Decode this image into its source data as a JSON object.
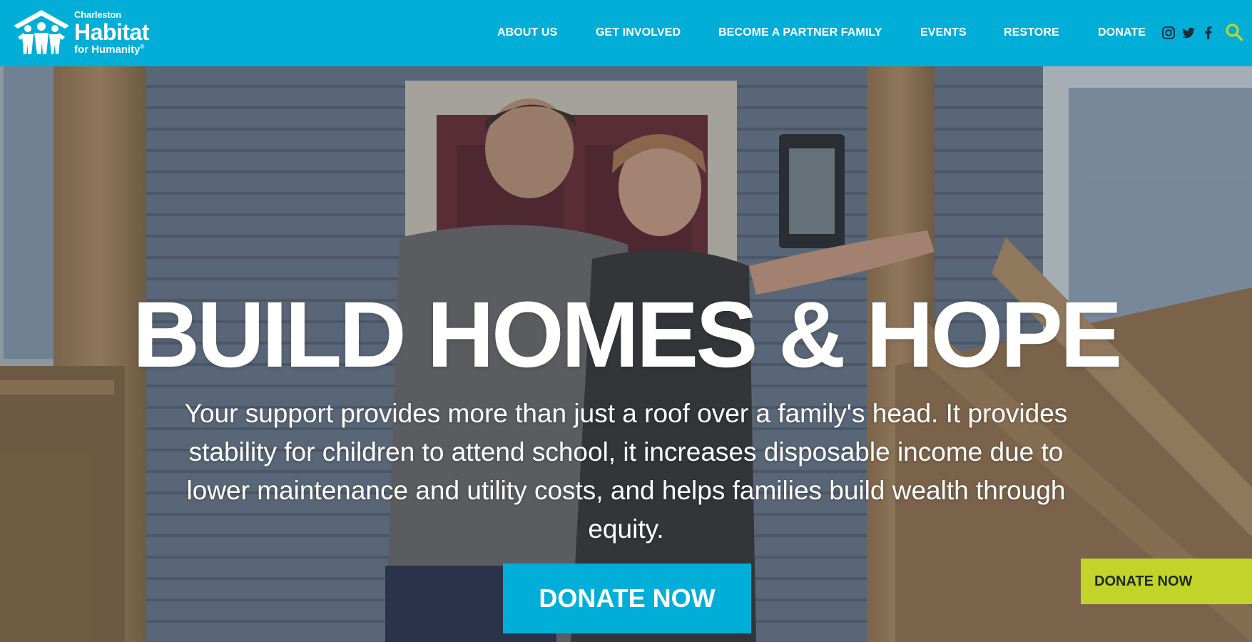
{
  "brand": {
    "line1": "Charleston",
    "line2": "Habitat",
    "line3": "for Humanity",
    "mark": "®"
  },
  "nav": {
    "items": [
      {
        "label": "ABOUT US"
      },
      {
        "label": "GET INVOLVED"
      },
      {
        "label": "BECOME A PARTNER FAMILY"
      },
      {
        "label": "EVENTS"
      },
      {
        "label": "RESTORE"
      },
      {
        "label": "DONATE"
      }
    ]
  },
  "social": {
    "icons": [
      "instagram-icon",
      "twitter-icon",
      "facebook-icon"
    ],
    "search_icon": "search-icon",
    "search_color": "#c2d42a"
  },
  "hero": {
    "headline": "BUILD HOMES & HOPE",
    "subtext": "Your support provides more than just a roof over a family's head. It provides stability for children to attend school, it increases disposable income due to lower maintenance and utility costs, and helps families build wealth through equity.",
    "cta_label": "DONATE NOW"
  },
  "floating_donate": {
    "label": "DONATE NOW",
    "color": "#c2d42a"
  },
  "colors": {
    "header_bg": "#00aed8",
    "cta_bg": "#00aed8"
  }
}
